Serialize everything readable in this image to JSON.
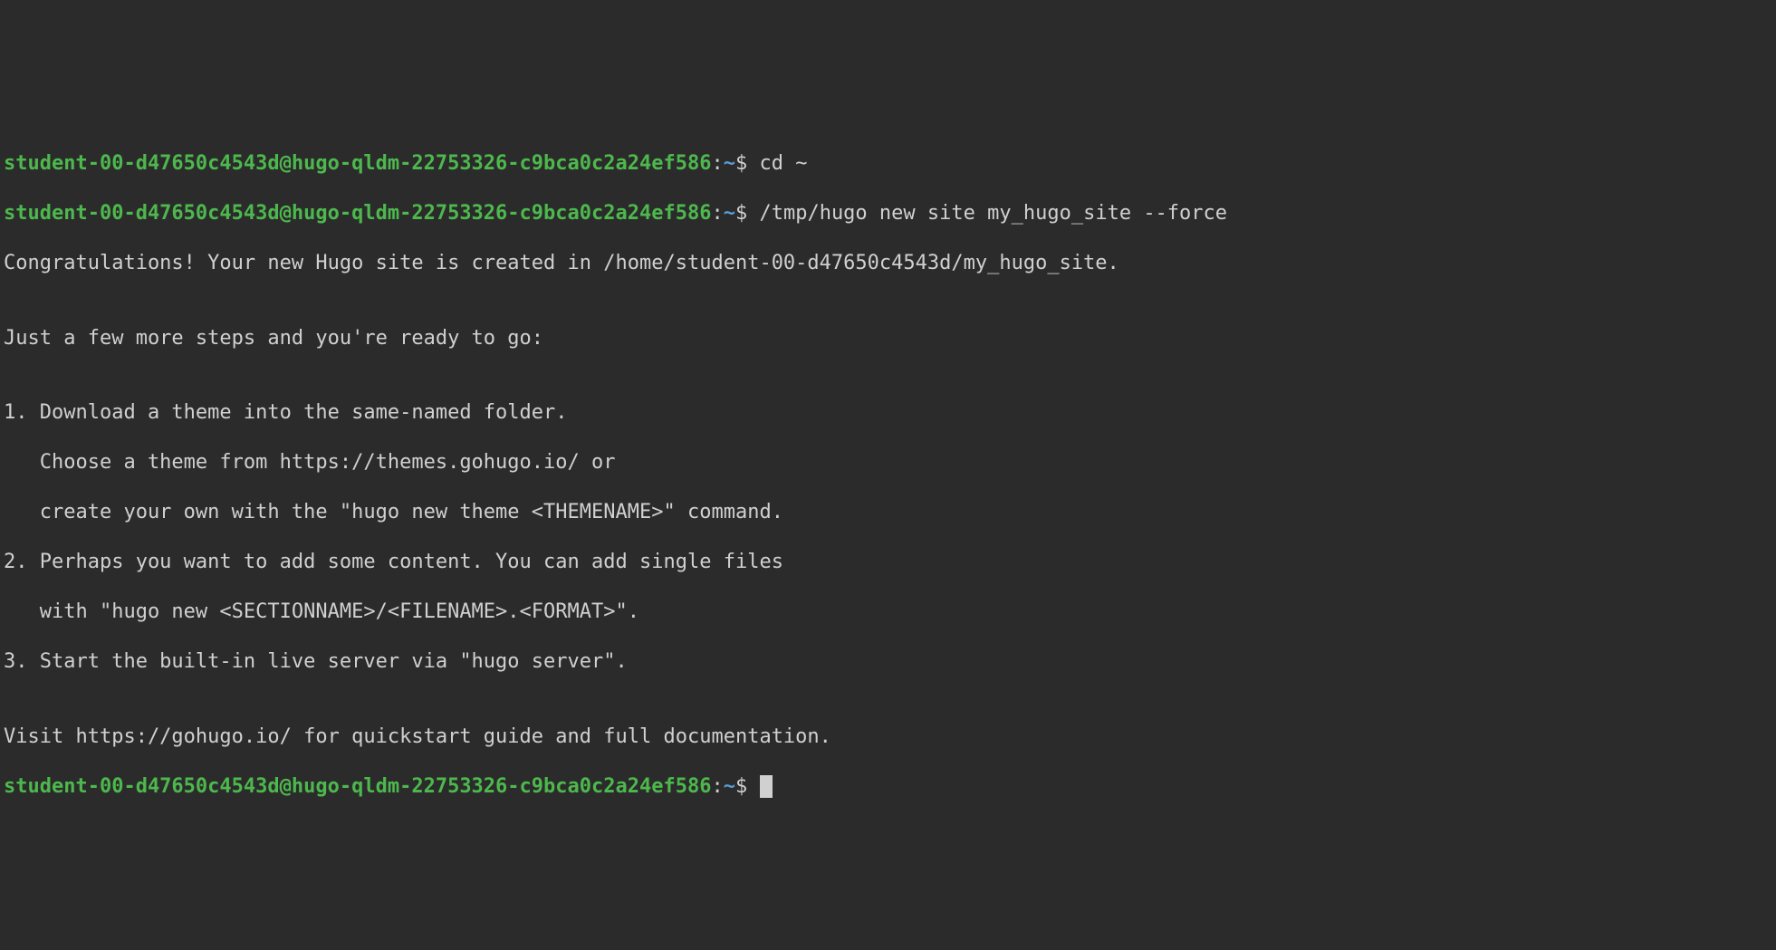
{
  "prompt": {
    "user": "student-00-d47650c4543d@hugo-qldm-22753326-c9bca0c2a24ef586",
    "sep1": ":",
    "path": "~",
    "dollar": "$"
  },
  "commands": {
    "cd": "cd ~",
    "newsite": "/tmp/hugo new site my_hugo_site --force",
    "empty": ""
  },
  "output": {
    "congrats": "Congratulations! Your new Hugo site is created in /home/student-00-d47650c4543d/my_hugo_site.",
    "blank": "",
    "intro": "Just a few more steps and you're ready to go:",
    "s1a": "1. Download a theme into the same-named folder.",
    "s1b": "   Choose a theme from https://themes.gohugo.io/ or",
    "s1c": "   create your own with the \"hugo new theme <THEMENAME>\" command.",
    "s2a": "2. Perhaps you want to add some content. You can add single files",
    "s2b": "   with \"hugo new <SECTIONNAME>/<FILENAME>.<FORMAT>\".",
    "s3": "3. Start the built-in live server via \"hugo server\".",
    "visit": "Visit https://gohugo.io/ for quickstart guide and full documentation."
  }
}
